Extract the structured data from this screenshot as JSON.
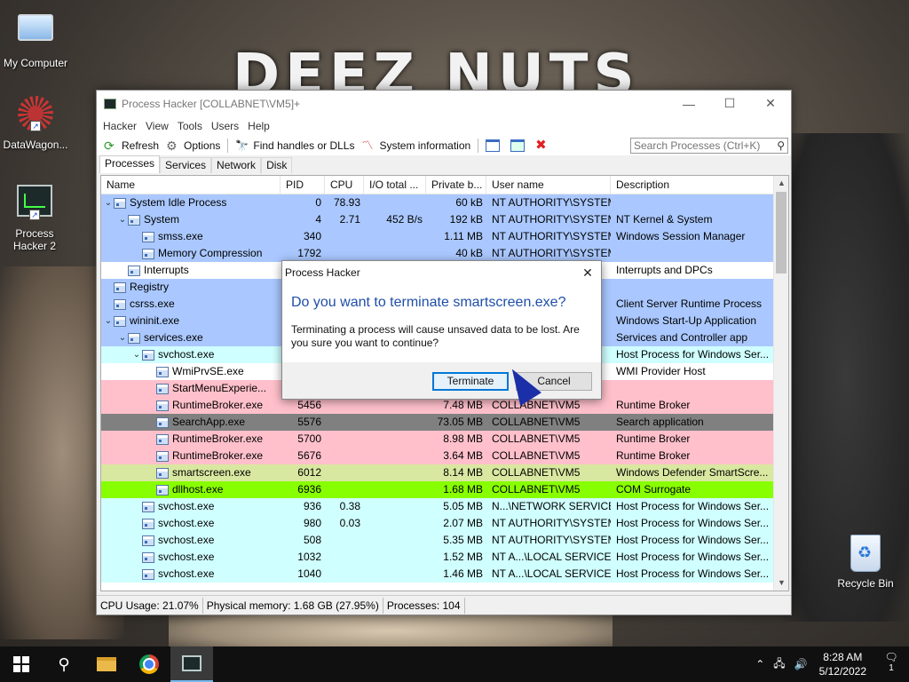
{
  "desktop": {
    "wallpaper_text": "DEEZ NUTS",
    "icons": [
      {
        "label": "My Computer"
      },
      {
        "label": "DataWagon..."
      },
      {
        "label": "Process Hacker 2"
      },
      {
        "label": "Recycle Bin"
      }
    ]
  },
  "window": {
    "title": "Process Hacker [COLLABNET\\VM5]+",
    "menu": [
      "Hacker",
      "View",
      "Tools",
      "Users",
      "Help"
    ],
    "toolbar": {
      "refresh": "Refresh",
      "options": "Options",
      "find_handles": "Find handles or DLLs",
      "system_info": "System information"
    },
    "search": {
      "placeholder": "Search Processes (Ctrl+K)"
    },
    "tabs": [
      "Processes",
      "Services",
      "Network",
      "Disk"
    ],
    "columns": [
      "Name",
      "PID",
      "CPU",
      "I/O total ...",
      "Private b...",
      "User name",
      "Description"
    ],
    "rows": [
      {
        "name": "System Idle Process",
        "pid": "0",
        "cpu": "78.93",
        "io": "",
        "priv": "60 kB",
        "user": "NT AUTHORITY\\SYSTEM",
        "desc": "",
        "indent": 0,
        "exp": "v",
        "bg": "#aac8ff"
      },
      {
        "name": "System",
        "pid": "4",
        "cpu": "2.71",
        "io": "452 B/s",
        "priv": "192 kB",
        "user": "NT AUTHORITY\\SYSTEM",
        "desc": "NT Kernel & System",
        "indent": 1,
        "exp": "v",
        "bg": "#aac8ff"
      },
      {
        "name": "smss.exe",
        "pid": "340",
        "cpu": "",
        "io": "",
        "priv": "1.11 MB",
        "user": "NT AUTHORITY\\SYSTEM",
        "desc": "Windows Session Manager",
        "indent": 2,
        "exp": "",
        "bg": "#aac8ff"
      },
      {
        "name": "Memory Compression",
        "pid": "1792",
        "cpu": "",
        "io": "",
        "priv": "40 kB",
        "user": "NT AUTHORITY\\SYSTEM",
        "desc": "",
        "indent": 2,
        "exp": "",
        "bg": "#aac8ff"
      },
      {
        "name": "Interrupts",
        "pid": "",
        "cpu": "",
        "io": "",
        "priv": "",
        "user": "",
        "desc": "Interrupts and DPCs",
        "indent": 1,
        "exp": "",
        "bg": "#ffffff"
      },
      {
        "name": "Registry",
        "pid": "",
        "cpu": "",
        "io": "",
        "priv": "",
        "user": "M",
        "desc": "",
        "indent": 0,
        "exp": "",
        "bg": "#aac8ff"
      },
      {
        "name": "csrss.exe",
        "pid": "",
        "cpu": "",
        "io": "",
        "priv": "",
        "user": "M",
        "desc": "Client Server Runtime Process",
        "indent": 0,
        "exp": "",
        "bg": "#aac8ff"
      },
      {
        "name": "wininit.exe",
        "pid": "",
        "cpu": "",
        "io": "",
        "priv": "",
        "user": "M",
        "desc": "Windows Start-Up Application",
        "indent": 0,
        "exp": "v",
        "bg": "#aac8ff"
      },
      {
        "name": "services.exe",
        "pid": "",
        "cpu": "",
        "io": "",
        "priv": "",
        "user": "M",
        "desc": "Services and Controller app",
        "indent": 1,
        "exp": "v",
        "bg": "#aac8ff"
      },
      {
        "name": "svchost.exe",
        "pid": "",
        "cpu": "",
        "io": "",
        "priv": "",
        "user": "M",
        "desc": "Host Process for Windows Ser...",
        "indent": 2,
        "exp": "v",
        "bg": "#d0ffff"
      },
      {
        "name": "WmiPrvSE.exe",
        "pid": "",
        "cpu": "",
        "io": "",
        "priv": "",
        "user": "M",
        "desc": "WMI Provider Host",
        "indent": 3,
        "exp": "",
        "bg": "#ffffff"
      },
      {
        "name": "StartMenuExperie...",
        "pid": "",
        "cpu": "",
        "io": "",
        "priv": "",
        "user": "",
        "desc": "",
        "indent": 3,
        "exp": "",
        "bg": "#ffc0cb"
      },
      {
        "name": "RuntimeBroker.exe",
        "pid": "5456",
        "cpu": "",
        "io": "",
        "priv": "7.48 MB",
        "user": "COLLABNET\\VM5",
        "desc": "Runtime Broker",
        "indent": 3,
        "exp": "",
        "bg": "#ffc0cb"
      },
      {
        "name": "SearchApp.exe",
        "pid": "5576",
        "cpu": "",
        "io": "",
        "priv": "73.05 MB",
        "user": "COLLABNET\\VM5",
        "desc": "Search application",
        "indent": 3,
        "exp": "",
        "bg": "#808080"
      },
      {
        "name": "RuntimeBroker.exe",
        "pid": "5700",
        "cpu": "",
        "io": "",
        "priv": "8.98 MB",
        "user": "COLLABNET\\VM5",
        "desc": "Runtime Broker",
        "indent": 3,
        "exp": "",
        "bg": "#ffc0cb"
      },
      {
        "name": "RuntimeBroker.exe",
        "pid": "5676",
        "cpu": "",
        "io": "",
        "priv": "3.64 MB",
        "user": "COLLABNET\\VM5",
        "desc": "Runtime Broker",
        "indent": 3,
        "exp": "",
        "bg": "#ffc0cb"
      },
      {
        "name": "smartscreen.exe",
        "pid": "6012",
        "cpu": "",
        "io": "",
        "priv": "8.14 MB",
        "user": "COLLABNET\\VM5",
        "desc": "Windows Defender SmartScre...",
        "indent": 3,
        "exp": "",
        "bg": "#d9e8a0"
      },
      {
        "name": "dllhost.exe",
        "pid": "6936",
        "cpu": "",
        "io": "",
        "priv": "1.68 MB",
        "user": "COLLABNET\\VM5",
        "desc": "COM Surrogate",
        "indent": 3,
        "exp": "",
        "bg": "#88ff00"
      },
      {
        "name": "svchost.exe",
        "pid": "936",
        "cpu": "0.38",
        "io": "",
        "priv": "5.05 MB",
        "user": "N...\\NETWORK SERVICE",
        "desc": "Host Process for Windows Ser...",
        "indent": 2,
        "exp": "",
        "bg": "#d0ffff"
      },
      {
        "name": "svchost.exe",
        "pid": "980",
        "cpu": "0.03",
        "io": "",
        "priv": "2.07 MB",
        "user": "NT AUTHORITY\\SYSTEM",
        "desc": "Host Process for Windows Ser...",
        "indent": 2,
        "exp": "",
        "bg": "#d0ffff"
      },
      {
        "name": "svchost.exe",
        "pid": "508",
        "cpu": "",
        "io": "",
        "priv": "5.35 MB",
        "user": "NT AUTHORITY\\SYSTEM",
        "desc": "Host Process for Windows Ser...",
        "indent": 2,
        "exp": "",
        "bg": "#d0ffff"
      },
      {
        "name": "svchost.exe",
        "pid": "1032",
        "cpu": "",
        "io": "",
        "priv": "1.52 MB",
        "user": "NT A...\\LOCAL SERVICE",
        "desc": "Host Process for Windows Ser...",
        "indent": 2,
        "exp": "",
        "bg": "#d0ffff"
      },
      {
        "name": "svchost.exe",
        "pid": "1040",
        "cpu": "",
        "io": "",
        "priv": "1.46 MB",
        "user": "NT A...\\LOCAL SERVICE",
        "desc": "Host Process for Windows Ser...",
        "indent": 2,
        "exp": "",
        "bg": "#d0ffff"
      }
    ],
    "status": {
      "cpu": "CPU Usage: 21.07%",
      "memory": "Physical memory: 1.68 GB (27.95%)",
      "processes": "Processes: 104"
    }
  },
  "dialog": {
    "title": "Process Hacker",
    "main": "Do you want to terminate smartscreen.exe?",
    "text": "Terminating a process will cause unsaved data to be lost. Are you sure you want to continue?",
    "terminate": "Terminate",
    "cancel": "Cancel"
  },
  "taskbar": {
    "time": "8:28 AM",
    "date": "5/12/2022",
    "notifications": "1"
  }
}
